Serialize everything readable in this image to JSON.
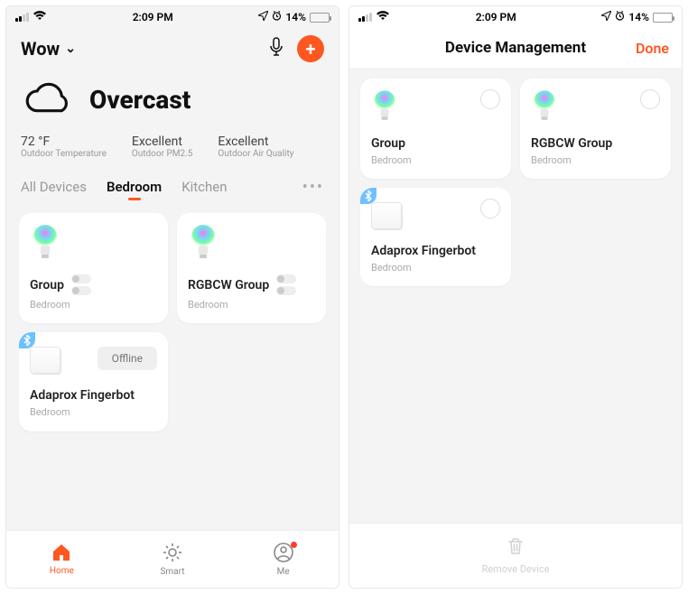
{
  "status": {
    "time": "2:09 PM",
    "battery_pct": "14%"
  },
  "left": {
    "home_name": "Wow",
    "weather": {
      "condition": "Overcast",
      "metrics": [
        {
          "value": "72 °F",
          "label": "Outdoor Temperature"
        },
        {
          "value": "Excellent",
          "label": "Outdoor PM2.5"
        },
        {
          "value": "Excellent",
          "label": "Outdoor Air Quality"
        }
      ]
    },
    "tabs": {
      "items": [
        "All Devices",
        "Bedroom",
        "Kitchen"
      ],
      "active": "Bedroom"
    },
    "devices": [
      {
        "name": "Group",
        "room": "Bedroom",
        "kind": "bulb",
        "toggles": true
      },
      {
        "name": "RGBCW Group",
        "room": "Bedroom",
        "kind": "bulb",
        "toggles": true
      },
      {
        "name": "Adaprox Fingerbot",
        "room": "Bedroom",
        "kind": "fingerbot",
        "status": "Offline",
        "bluetooth": true
      }
    ],
    "nav": {
      "home": "Home",
      "smart": "Smart",
      "me": "Me",
      "me_badge": true
    }
  },
  "right": {
    "title": "Device Management",
    "done": "Done",
    "devices": [
      {
        "name": "Group",
        "room": "Bedroom",
        "kind": "bulb"
      },
      {
        "name": "RGBCW Group",
        "room": "Bedroom",
        "kind": "bulb"
      },
      {
        "name": "Adaprox Fingerbot",
        "room": "Bedroom",
        "kind": "fingerbot",
        "bluetooth": true
      }
    ],
    "footer": "Remove Device"
  }
}
